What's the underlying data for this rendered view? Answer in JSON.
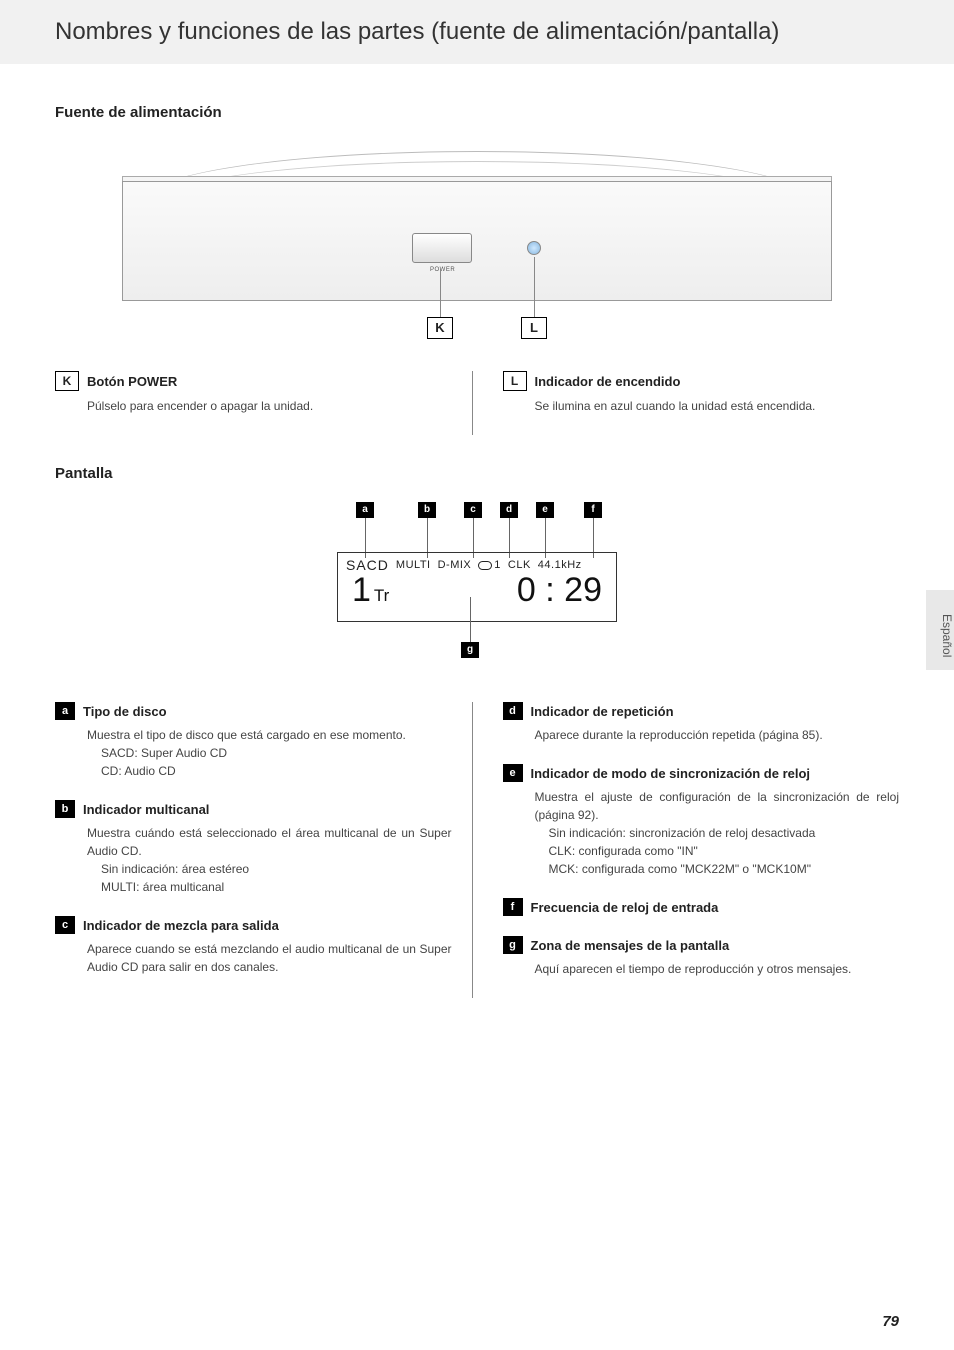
{
  "header": {
    "title": "Nombres y funciones de las partes (fuente de alimentación/pantalla)"
  },
  "sideTab": "Español",
  "pageNumber": "79",
  "power": {
    "sectionTitle": "Fuente de alimentación",
    "tinyLabel": "POWER",
    "callouts": {
      "K": "K",
      "L": "L"
    },
    "items": [
      {
        "badge": "K",
        "title": "Botón POWER",
        "body": "Púlselo para encender o apagar la unidad."
      },
      {
        "badge": "L",
        "title": "Indicador de encendido",
        "body": "Se ilumina en azul cuando la unidad está encendida."
      }
    ]
  },
  "display": {
    "sectionTitle": "Pantalla",
    "lcd": {
      "sacd": "SACD",
      "multi": "MULTI",
      "dmix": "D-MIX",
      "repeatNum": "1",
      "clk": "CLK",
      "freq": "44.1kHz",
      "track": "1",
      "trLabel": "Tr",
      "time": "0 : 29"
    },
    "labels": {
      "a": "a",
      "b": "b",
      "c": "c",
      "d": "d",
      "e": "e",
      "f": "f",
      "g": "g"
    },
    "itemsLeft": [
      {
        "badge": "a",
        "title": "Tipo de disco",
        "body": "Muestra el tipo de disco que está cargado en ese momento.",
        "subs": [
          "SACD: Super Audio CD",
          "CD: Audio CD"
        ]
      },
      {
        "badge": "b",
        "title": "Indicador multicanal",
        "body": "Muestra cuándo está seleccionado el área multicanal de un Super Audio CD.",
        "subs": [
          "Sin indicación: área estéreo",
          "MULTI: área multicanal"
        ]
      },
      {
        "badge": "c",
        "title": "Indicador de mezcla para salida",
        "body": "Aparece cuando se está mezclando el audio multicanal de un Super Audio CD para salir en dos canales.",
        "subs": []
      }
    ],
    "itemsRight": [
      {
        "badge": "d",
        "title": "Indicador de repetición",
        "body": "Aparece durante la reproducción repetida (página 85).",
        "subs": []
      },
      {
        "badge": "e",
        "title": "Indicador de modo de sincronización de reloj",
        "body": "Muestra el ajuste de configuración de la sincronización de reloj (página 92).",
        "subs": [
          "Sin indicación: sincronización de reloj desactivada",
          "CLK: configurada como \"IN\"",
          "MCK: configurada como \"MCK22M\" o \"MCK10M\""
        ]
      },
      {
        "badge": "f",
        "title": "Frecuencia de reloj de entrada",
        "body": "",
        "subs": []
      },
      {
        "badge": "g",
        "title": "Zona de mensajes de la pantalla",
        "body": "Aquí aparecen el tiempo de reproducción y otros mensajes.",
        "subs": []
      }
    ]
  }
}
